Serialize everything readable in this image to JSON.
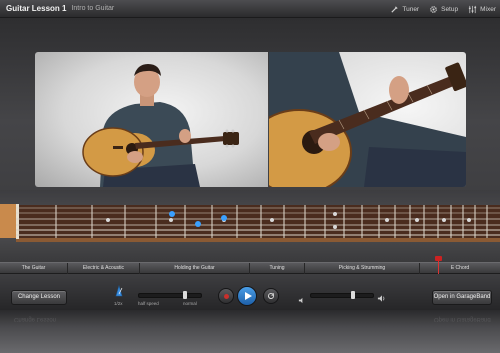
{
  "window": {
    "title": "Guitar Lesson 1",
    "subtitle": "Intro to Guitar"
  },
  "toolbar": {
    "tuner_label": "Tuner",
    "setup_label": "Setup",
    "mixer_label": "Mixer"
  },
  "chapters": [
    {
      "label": "The Guitar"
    },
    {
      "label": "Electric & Acoustic"
    },
    {
      "label": "Holding the Guitar"
    },
    {
      "label": "Tuning"
    },
    {
      "label": "Picking & Strumming"
    },
    {
      "label": "E Chord"
    }
  ],
  "controls": {
    "change_lesson_label": "Change Lesson",
    "speed_left_label": "1/2x",
    "speed_mid_label": "half speed",
    "speed_right_label": "normal",
    "open_garageband_label": "Open in GarageBand"
  },
  "colors": {
    "accent_blue": "#2f86d6",
    "record_red": "#c9302c",
    "fret_dot_blue": "#3aa0ff",
    "fretboard": "#4a2c1e"
  },
  "icons": [
    "tuner-icon",
    "setup-gear-icon",
    "mixer-icon",
    "metronome-icon",
    "record-icon",
    "play-icon",
    "loop-icon",
    "volume-low-icon",
    "volume-high-icon"
  ]
}
